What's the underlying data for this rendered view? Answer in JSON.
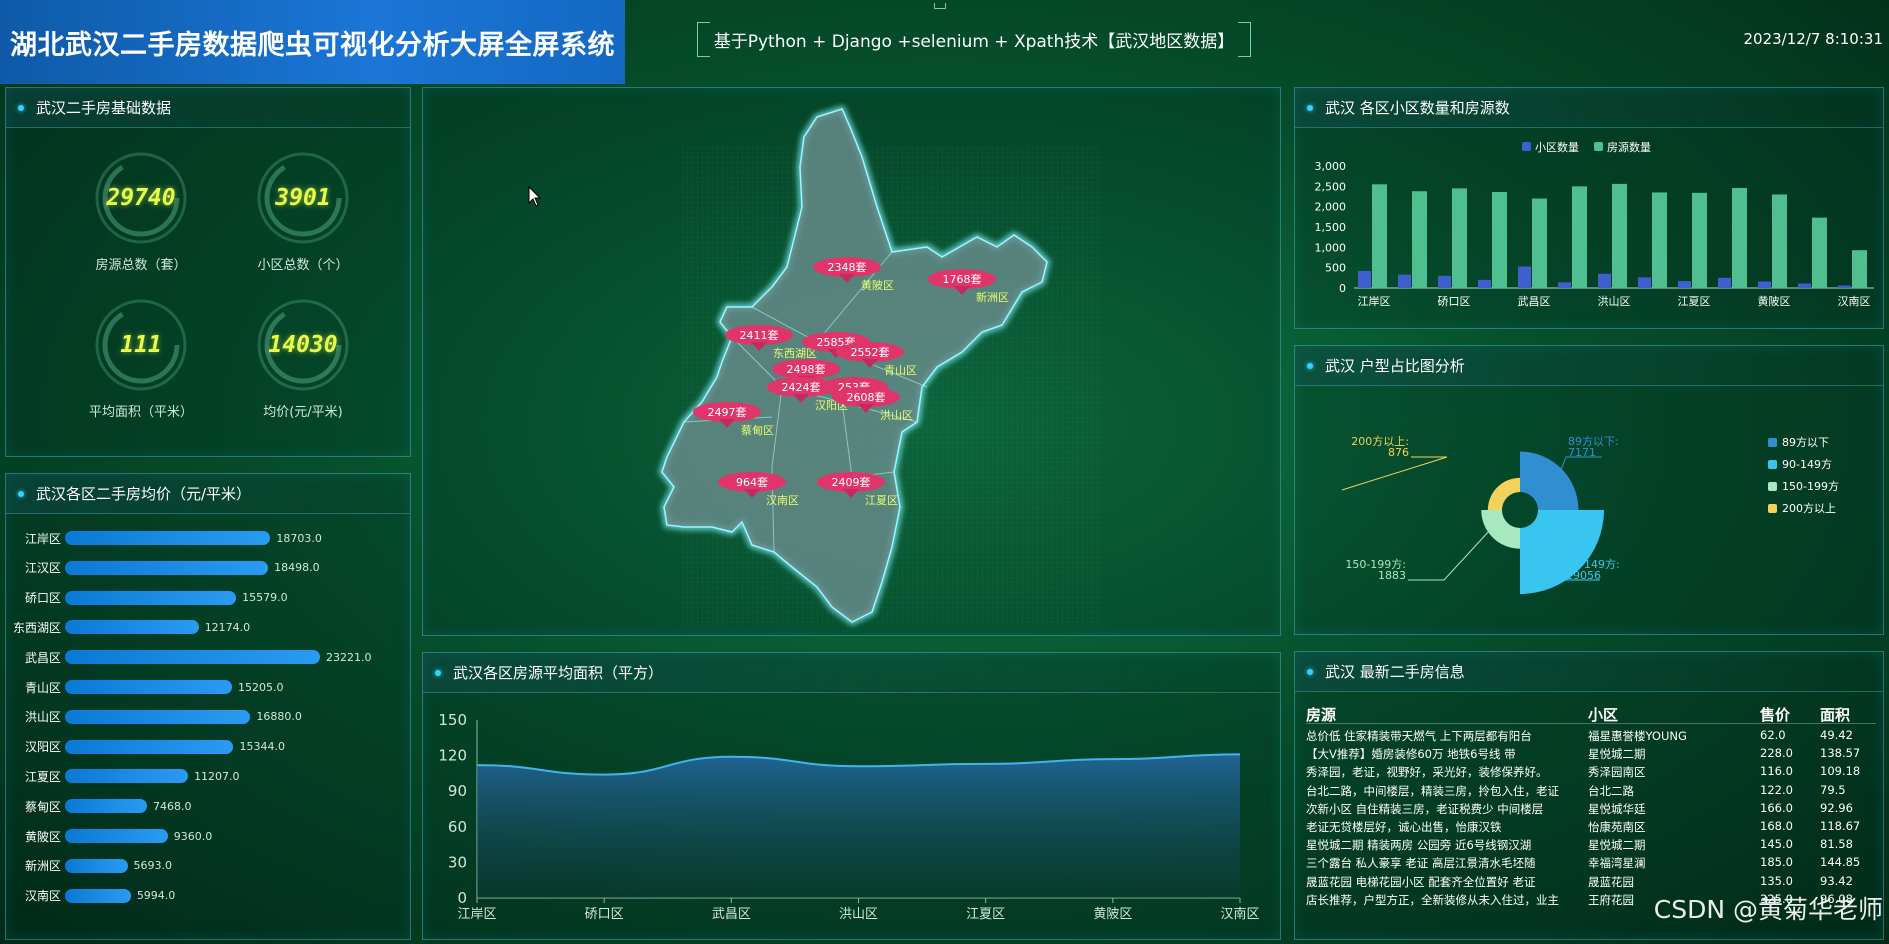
{
  "header": {
    "title": "湖北武汉二手房数据爬虫可视化分析大屏全屏系统",
    "subtitle": "基于Python + Django +selenium + Xpath技术【武汉地区数据】",
    "datetime": "2023/12/7 8:10:31"
  },
  "basic": {
    "title": "武汉二手房基础数据",
    "stats": [
      {
        "value": "29740",
        "label": "房源总数（套）"
      },
      {
        "value": "3901",
        "label": "小区总数（个）"
      },
      {
        "value": "111",
        "label": "平均面积（平米）"
      },
      {
        "value": "14030",
        "label": "均价(元/平米)"
      }
    ]
  },
  "price_panel": {
    "title": "武汉各区二手房均价（元/平米）",
    "rows": [
      {
        "name": "江岸区",
        "value": "18703.0",
        "num": 18703.0
      },
      {
        "name": "江汉区",
        "value": "18498.0",
        "num": 18498.0
      },
      {
        "name": "硚口区",
        "value": "15579.0",
        "num": 15579.0
      },
      {
        "name": "东西湖区",
        "value": "12174.0",
        "num": 12174.0
      },
      {
        "name": "武昌区",
        "value": "23221.0",
        "num": 23221.0
      },
      {
        "name": "青山区",
        "value": "15205.0",
        "num": 15205.0
      },
      {
        "name": "洪山区",
        "value": "16880.0",
        "num": 16880.0
      },
      {
        "name": "汉阳区",
        "value": "15344.0",
        "num": 15344.0
      },
      {
        "name": "江夏区",
        "value": "11207.0",
        "num": 11207.0
      },
      {
        "name": "蔡甸区",
        "value": "7468.0",
        "num": 7468.0
      },
      {
        "name": "黄陂区",
        "value": "9360.0",
        "num": 9360.0
      },
      {
        "name": "新洲区",
        "value": "5693.0",
        "num": 5693.0
      },
      {
        "name": "汉南区",
        "value": "5994.0",
        "num": 5994.0
      }
    ]
  },
  "map_panel": {
    "markers": [
      {
        "count": "2348套",
        "district": "黄陂区"
      },
      {
        "count": "1768套",
        "district": "新洲区"
      },
      {
        "count": "2411套",
        "district": "东西湖区"
      },
      {
        "count": "2585套",
        "district": ""
      },
      {
        "count": "2552套",
        "district": "青山区"
      },
      {
        "count": "2498套",
        "district": ""
      },
      {
        "count": "2424套",
        "district": "汉阳区"
      },
      {
        "count": "253套",
        "district": ""
      },
      {
        "count": "2608套",
        "district": "洪山区"
      },
      {
        "count": "2497套",
        "district": "蔡甸区"
      },
      {
        "count": "964套",
        "district": "汉南区"
      },
      {
        "count": "2409套",
        "district": "江夏区"
      }
    ]
  },
  "area_panel": {
    "title": "武汉各区房源平均面积（平方）"
  },
  "count_panel": {
    "title": "武汉 各区小区数量和房源数"
  },
  "pie_panel": {
    "title": "武汉 户型占比图分析"
  },
  "table_panel": {
    "title": "武汉 最新二手房信息",
    "headers": [
      "房源",
      "小区",
      "售价",
      "面积"
    ],
    "rows": [
      [
        "总价低 住家精装带天燃气 上下两层都有阳台",
        "福星惠誉楼YOUNG",
        "62.0",
        "49.42"
      ],
      [
        "【大V推荐】婚房装修60万 地铁6号线 带",
        "星悦城二期",
        "228.0",
        "138.57"
      ],
      [
        "秀泽园，老证，视野好，采光好，装修保养好。",
        "秀泽园南区",
        "116.0",
        "109.18"
      ],
      [
        "台北二路，中间楼层，精装三房，拎包入住，老证",
        "台北二路",
        "122.0",
        "79.5"
      ],
      [
        "次新小区 自住精装三房，老证税费少 中间楼层",
        "星悦城华廷",
        "166.0",
        "92.96"
      ],
      [
        "老证无贷楼层好，诚心出售，怡康汉铁",
        "怡康苑南区",
        "168.0",
        "118.67"
      ],
      [
        "星悦城二期 精装两房 公园旁 近6号线钢汉湖",
        "星悦城二期",
        "145.0",
        "81.58"
      ],
      [
        "三个露台 私人豪享 老证 高层江景清水毛坯随",
        "幸福湾星澜",
        "185.0",
        "144.85"
      ],
      [
        "晟蓝花园 电梯花园小区 配套齐全位置好 老证",
        "晟蓝花园",
        "135.0",
        "93.42"
      ],
      [
        "店长推荐，户型方正，全新装修从未入住过，业主",
        "王府花园",
        "325.0",
        "96.08"
      ]
    ]
  },
  "watermark": "CSDN @黄菊华老师",
  "chart_data": [
    {
      "type": "line",
      "title": "武汉各区房源平均面积（平方）",
      "categories": [
        "江岸区",
        "硚口区",
        "武昌区",
        "洪山区",
        "江夏区",
        "黄陂区",
        "汉南区"
      ],
      "values": [
        112,
        104,
        119,
        111,
        113,
        117,
        121
      ],
      "ylim": [
        0,
        150
      ],
      "yticks": [
        "0",
        "30",
        "60",
        "90",
        "120",
        "150"
      ],
      "grid": false,
      "area": true
    },
    {
      "type": "bar",
      "title": "武汉 各区小区数量和房源数",
      "categories": [
        "江岸区",
        "江汉区",
        "硚口区",
        "东西湖区",
        "武昌区",
        "青山区",
        "洪山区",
        "汉阳区",
        "江夏区",
        "蔡甸区",
        "黄陂区",
        "新洲区",
        "汉南区"
      ],
      "xticks": [
        "江岸区",
        "硚口区",
        "武昌区",
        "洪山区",
        "江夏区",
        "黄陂区",
        "汉南区"
      ],
      "series": [
        {
          "name": "小区数量",
          "color": "#3f5fd0",
          "values": [
            420,
            330,
            300,
            200,
            530,
            140,
            350,
            260,
            170,
            250,
            160,
            110,
            60
          ]
        },
        {
          "name": "房源数量",
          "color": "#4fbf8f",
          "values": [
            2550,
            2380,
            2450,
            2360,
            2200,
            2500,
            2560,
            2350,
            2340,
            2460,
            2300,
            1730,
            930
          ]
        }
      ],
      "ylim": [
        0,
        3000
      ],
      "yticks": [
        "0",
        "500",
        "1,000",
        "1,500",
        "2,000",
        "2,500",
        "3,000"
      ],
      "legend": "top-center"
    },
    {
      "type": "pie",
      "title": "武汉 户型占比图分析",
      "slices": [
        {
          "name": "89方以下",
          "value": 7171,
          "color": "#2f8fd0",
          "label": "89方以下:",
          "value_label": "7171"
        },
        {
          "name": "90-149方",
          "value": 19056,
          "color": "#38c6f0",
          "label": "90-149方:",
          "value_label": "19056"
        },
        {
          "name": "150-199方",
          "value": 1883,
          "color": "#a8e8c0",
          "label": "150-199方:",
          "value_label": "1883"
        },
        {
          "name": "200方以上",
          "value": 876,
          "color": "#f2d25a",
          "label": "200方以上:",
          "value_label": "876"
        }
      ],
      "rose": true,
      "legend": "right"
    }
  ]
}
